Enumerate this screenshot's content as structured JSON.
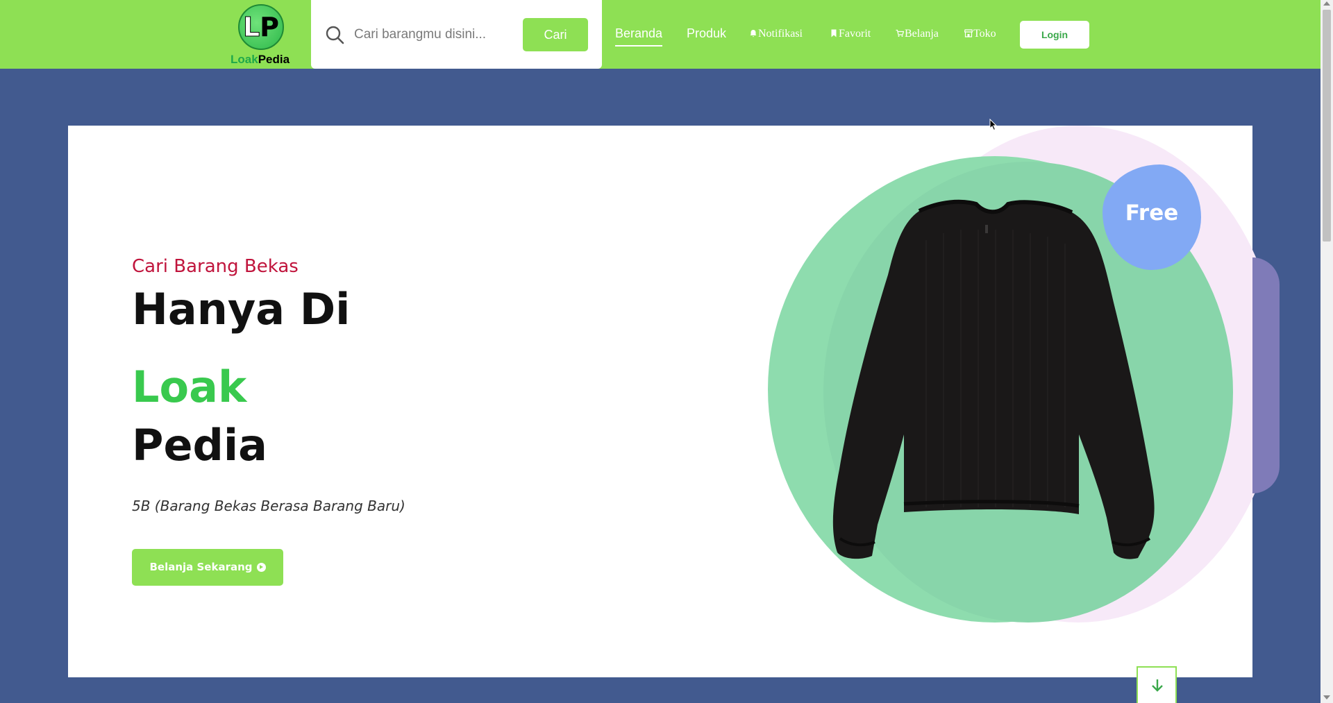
{
  "brand": {
    "logo_letters": "LP",
    "name_part1": "Loak",
    "name_part2": "Pedia",
    "brand_green": "#8ee054"
  },
  "search": {
    "placeholder": "Cari barangmu disini...",
    "button_label": "Cari",
    "icon": "search-icon"
  },
  "nav": {
    "items": [
      {
        "label": "Beranda",
        "active": true
      },
      {
        "label": "Produk",
        "active": false
      },
      {
        "label": "Notifikasi",
        "icon": "bell-icon"
      },
      {
        "label": "Favorit",
        "icon": "bookmark-icon"
      },
      {
        "label": "Belanja",
        "icon": "cart-icon"
      },
      {
        "label": "Toko",
        "icon": "store-icon"
      }
    ],
    "login_label": "Login"
  },
  "hero": {
    "subtitle": "Cari Barang Bekas",
    "headline_1": "Hanya Di",
    "headline_2": "Loak",
    "headline_3": "Pedia",
    "tagline": "5B (Barang Bekas Berasa Barang Baru)",
    "cta_label": "Belanja Sekarang",
    "badge": "Free",
    "accent_red": "#c0143c",
    "accent_green": "#39c94e"
  },
  "colors": {
    "page_background": "#425a8f",
    "nav_background": "#8ee054",
    "badge_blue": "#82a9f4",
    "circle_green": "#8edcae"
  }
}
